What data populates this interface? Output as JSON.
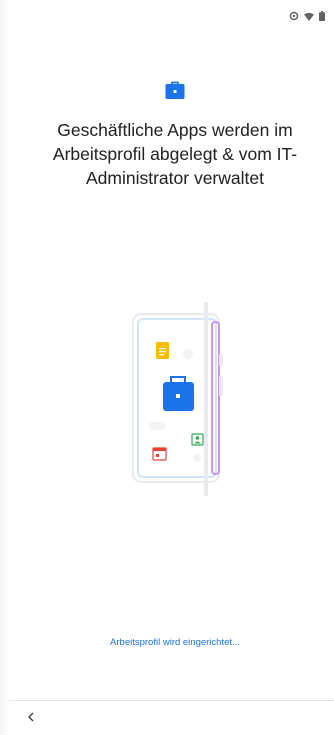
{
  "status_bar": {
    "icons": [
      "data-saver-icon",
      "wifi-icon",
      "battery-icon"
    ]
  },
  "header": {
    "icon": "briefcase-icon",
    "title": "Geschäftliche Apps werden im Arbeitsprofil abgelegt & vom IT-Administrator verwaltet"
  },
  "illustration": {
    "icons": [
      "document-icon",
      "briefcase-icon",
      "contact-icon",
      "calendar-icon"
    ]
  },
  "progress": {
    "status_text": "Arbeitsprofil wird eingerichtet..."
  },
  "nav": {
    "back_icon": "chevron-left-icon"
  },
  "colors": {
    "accent": "#1a73e8",
    "title_text": "#202124",
    "phone_outline": "#d2e3fc",
    "purple_accent": "#c58af9"
  }
}
